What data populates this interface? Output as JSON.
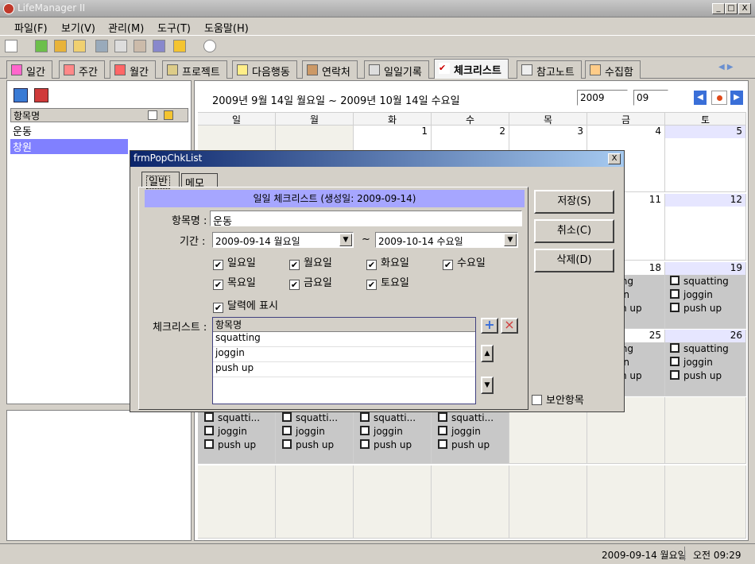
{
  "window": {
    "title": "LifeManager II",
    "minimize": "_",
    "maximize": "□",
    "close": "X"
  },
  "menu": [
    "파일(F)",
    "보기(V)",
    "관리(M)",
    "도구(T)",
    "도움말(H)"
  ],
  "tabs": [
    "일간",
    "주간",
    "월간",
    "프로젝트",
    "다음행동",
    "연락처",
    "일일기록",
    "체크리스트",
    "참고노트",
    "수집함"
  ],
  "active_tab": "체크리스트",
  "left_list": {
    "header": "항목명",
    "items": [
      "운동",
      "창원"
    ],
    "selected": "창원"
  },
  "calendar": {
    "range": "2009년 9월 14일 월요일 ~ 2009년 10월 14일 수요일",
    "year": "2009",
    "month": "09",
    "weekdays": [
      "일",
      "월",
      "화",
      "수",
      "목",
      "금",
      "토"
    ],
    "row1": [
      "",
      "",
      "1",
      "2",
      "3",
      "4",
      "5"
    ],
    "row2_visible": [
      "11",
      "12"
    ],
    "row3_visible": [
      "18",
      "19"
    ],
    "row4_visible": [
      "25",
      "26"
    ],
    "tasks": [
      "squatting",
      "joggin",
      "push up"
    ],
    "tasks_truncated": [
      "squatti...",
      "joggin",
      "push up"
    ],
    "partial_tasks": [
      "tting",
      "in",
      "h up"
    ]
  },
  "dialog": {
    "title": "frmPopChkList",
    "tabs": [
      "일반",
      "메모"
    ],
    "header": "일일 체크리스트 (생성일: 2009-09-14)",
    "name_label": "항목명 :",
    "name_value": "운동",
    "period_label": "기간 :",
    "start": "2009-09-14 월요일",
    "tilde": "~",
    "end": "2009-10-14 수요일",
    "days": [
      "일요일",
      "월요일",
      "화요일",
      "수요일",
      "목요일",
      "금요일",
      "토요일"
    ],
    "show_in_calendar": "달력에 표시",
    "checklist_label": "체크리스트 :",
    "checklist_header": "항목명",
    "checklist_items": [
      "squatting",
      "joggin",
      "push up"
    ],
    "buttons": {
      "save": "저장(S)",
      "cancel": "취소(C)",
      "delete": "삭제(D)"
    },
    "secure": "보안항목",
    "add_symbol": "+",
    "remove_symbol": "×",
    "up_symbol": "▲",
    "down_symbol": "▼",
    "dropdown_symbol": "▼",
    "check_symbol": "✔"
  },
  "status": {
    "date": "2009-09-14 월요일",
    "time": "오전 09:29"
  },
  "colors": {
    "accent": "#0a246a",
    "selection": "#8080ff",
    "saturday": "#e6e6ff",
    "dialog_header": "#a6a6ff"
  }
}
